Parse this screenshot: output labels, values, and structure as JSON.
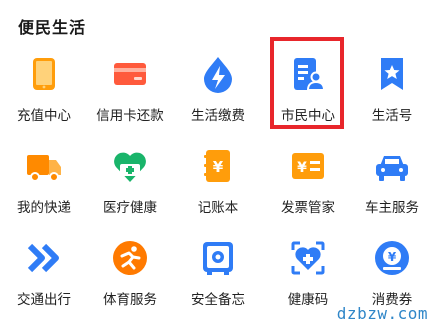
{
  "section": {
    "title": "便民生活"
  },
  "items": [
    {
      "label": "充值中心",
      "icon": "phone-icon",
      "color": "#ff9d0b"
    },
    {
      "label": "信用卡还款",
      "icon": "credit-card-icon",
      "color": "#ff5a3c"
    },
    {
      "label": "生活缴费",
      "icon": "utility-drop-icon",
      "color": "#2f7cf6"
    },
    {
      "label": "市民中心",
      "icon": "citizen-card-icon",
      "color": "#2f7cf6"
    },
    {
      "label": "生活号",
      "icon": "bookmark-star-icon",
      "color": "#2f7cf6"
    },
    {
      "label": "我的快递",
      "icon": "delivery-truck-icon",
      "color": "#ff8a00"
    },
    {
      "label": "医疗健康",
      "icon": "health-heart-icon",
      "color": "#19b46a"
    },
    {
      "label": "记账本",
      "icon": "ledger-yen-icon",
      "color": "#ff9d0b"
    },
    {
      "label": "发票管家",
      "icon": "invoice-yen-icon",
      "color": "#ff9d0b"
    },
    {
      "label": "车主服务",
      "icon": "car-icon",
      "color": "#2f7cf6"
    },
    {
      "label": "交通出行",
      "icon": "transit-arrows-icon",
      "color": "#2f7cf6"
    },
    {
      "label": "体育服务",
      "icon": "sports-runner-icon",
      "color": "#ff7a00"
    },
    {
      "label": "安全备忘",
      "icon": "safe-icon",
      "color": "#2f7cf6"
    },
    {
      "label": "健康码",
      "icon": "health-code-icon",
      "color": "#2f7cf6"
    },
    {
      "label": "消费券",
      "icon": "coupon-yen-icon",
      "color": "#2f7cf6"
    }
  ],
  "highlight_color": "#e8262b",
  "watermark": {
    "text": "dzbzw.com"
  }
}
